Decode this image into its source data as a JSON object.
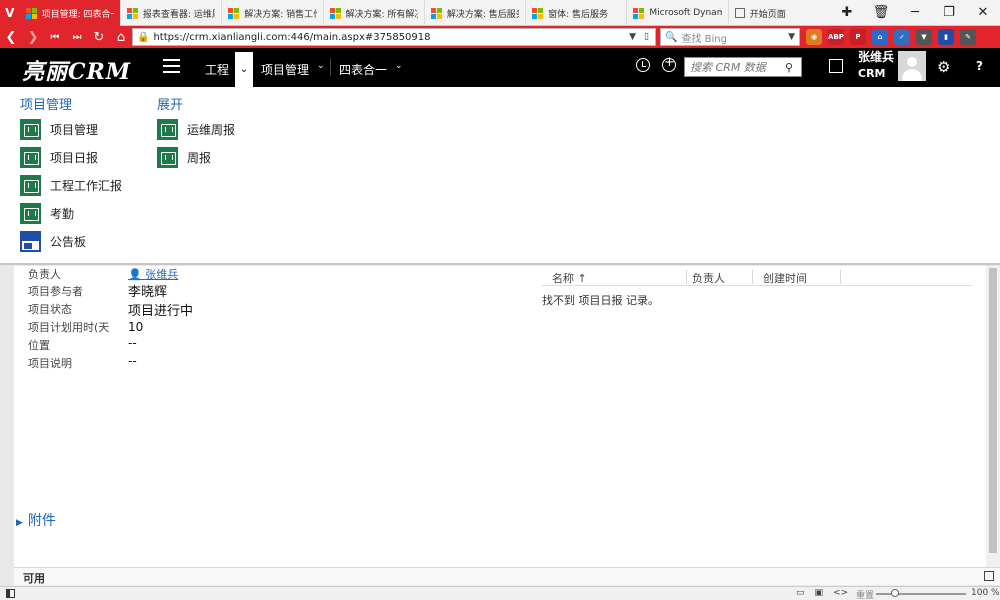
{
  "browser": {
    "logo_letter": "V",
    "tabs": [
      {
        "label": "项目管理: 四表合一",
        "active": true
      },
      {
        "label": "报表查看器: 运维周报",
        "active": false
      },
      {
        "label": "解决方案: 销售工作",
        "active": false
      },
      {
        "label": "解决方案: 所有解决",
        "active": false
      },
      {
        "label": "解决方案: 售后服务",
        "active": false
      },
      {
        "label": "窗体: 售后服务",
        "active": false
      },
      {
        "label": "Microsoft Dynamic",
        "active": false
      }
    ],
    "start_tab": "开始页面",
    "window_controls": {
      "new_tab": "✚",
      "trash": "🗑",
      "minimize": "─",
      "maximize": "❐",
      "close": "✕"
    },
    "url": "https://crm.xianliangli.com:446/main.aspx#375850918",
    "search_placeholder": "查找 Bing",
    "extensions": [
      {
        "name": "ext-orange",
        "color": "#e07a22",
        "label": "◉"
      },
      {
        "name": "adblock-plus",
        "color": "#c8202a",
        "label": "ABP"
      },
      {
        "name": "pinterest",
        "color": "#cc1d25",
        "label": "P"
      },
      {
        "name": "ext-blue-house",
        "color": "#2a6acb",
        "label": "⌂"
      },
      {
        "name": "ext-check",
        "color": "#2e6fbf",
        "label": "✓"
      },
      {
        "name": "pocket",
        "color": "#555555",
        "label": "▼"
      },
      {
        "name": "ext-blue-book",
        "color": "#1f4ea8",
        "label": "▮"
      },
      {
        "name": "ext-evernote",
        "color": "#555555",
        "label": "✎"
      }
    ],
    "zoom": "100 %",
    "reset_label": "重置"
  },
  "crm": {
    "logo": "亮丽CRM",
    "nav_area": "工程",
    "nav_entity": "项目管理",
    "nav_record": "四表合一",
    "search_placeholder": "搜索 CRM 数据",
    "user_name": "张维兵",
    "user_org": "CRM",
    "help": "?"
  },
  "flyout": {
    "groups": [
      {
        "title": "项目管理",
        "items": [
          {
            "label": "项目管理",
            "icon": "entity"
          },
          {
            "label": "项目日报",
            "icon": "entity"
          },
          {
            "label": "工程工作汇报",
            "icon": "entity"
          },
          {
            "label": "考勤",
            "icon": "entity"
          },
          {
            "label": "公告板",
            "icon": "board"
          }
        ]
      },
      {
        "title": "展开",
        "items": [
          {
            "label": "运维周报",
            "icon": "entity"
          },
          {
            "label": "周报",
            "icon": "entity"
          }
        ]
      }
    ]
  },
  "form": {
    "fields": [
      {
        "label": "负责人",
        "value": "张维兵"
      },
      {
        "label": "项目参与者",
        "value": "李晓辉"
      },
      {
        "label": "项目状态",
        "value": "项目进行中"
      },
      {
        "label": "项目计划用时(天",
        "value": "10"
      },
      {
        "label": "位置",
        "value": "--"
      },
      {
        "label": "项目说明",
        "value": "--"
      }
    ],
    "grid": {
      "columns": [
        "名称 ↑",
        "负责人",
        "创建时间"
      ],
      "empty_message": "找不到 项目日报 记录。"
    },
    "attachments_label": "附件",
    "status": "可用"
  }
}
